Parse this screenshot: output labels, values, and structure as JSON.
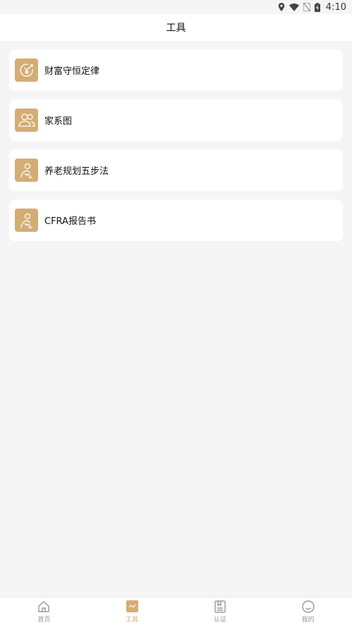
{
  "status_bar": {
    "time": "4:10",
    "icons": [
      "location-icon",
      "wifi-icon",
      "no-sim-icon",
      "battery-charging-icon"
    ]
  },
  "header": {
    "title": "工具"
  },
  "tools": [
    {
      "label": "财富守恒定律",
      "icon": "coin-target-icon"
    },
    {
      "label": "家系图",
      "icon": "family-people-icon"
    },
    {
      "label": "养老规划五步法",
      "icon": "person-walking-icon"
    },
    {
      "label": "CFRA报告书",
      "icon": "person-walking-icon"
    }
  ],
  "bottom_nav": {
    "items": [
      {
        "label": "首页",
        "icon": "home-icon",
        "active": false
      },
      {
        "label": "工具",
        "icon": "tool-chart-icon",
        "active": true
      },
      {
        "label": "认证",
        "icon": "certificate-icon",
        "active": false
      },
      {
        "label": "我的",
        "icon": "smile-face-icon",
        "active": false
      }
    ]
  },
  "colors": {
    "accent": "#d4ad74",
    "background": "#f5f5f5",
    "card": "#ffffff",
    "nav_inactive": "#999999"
  }
}
